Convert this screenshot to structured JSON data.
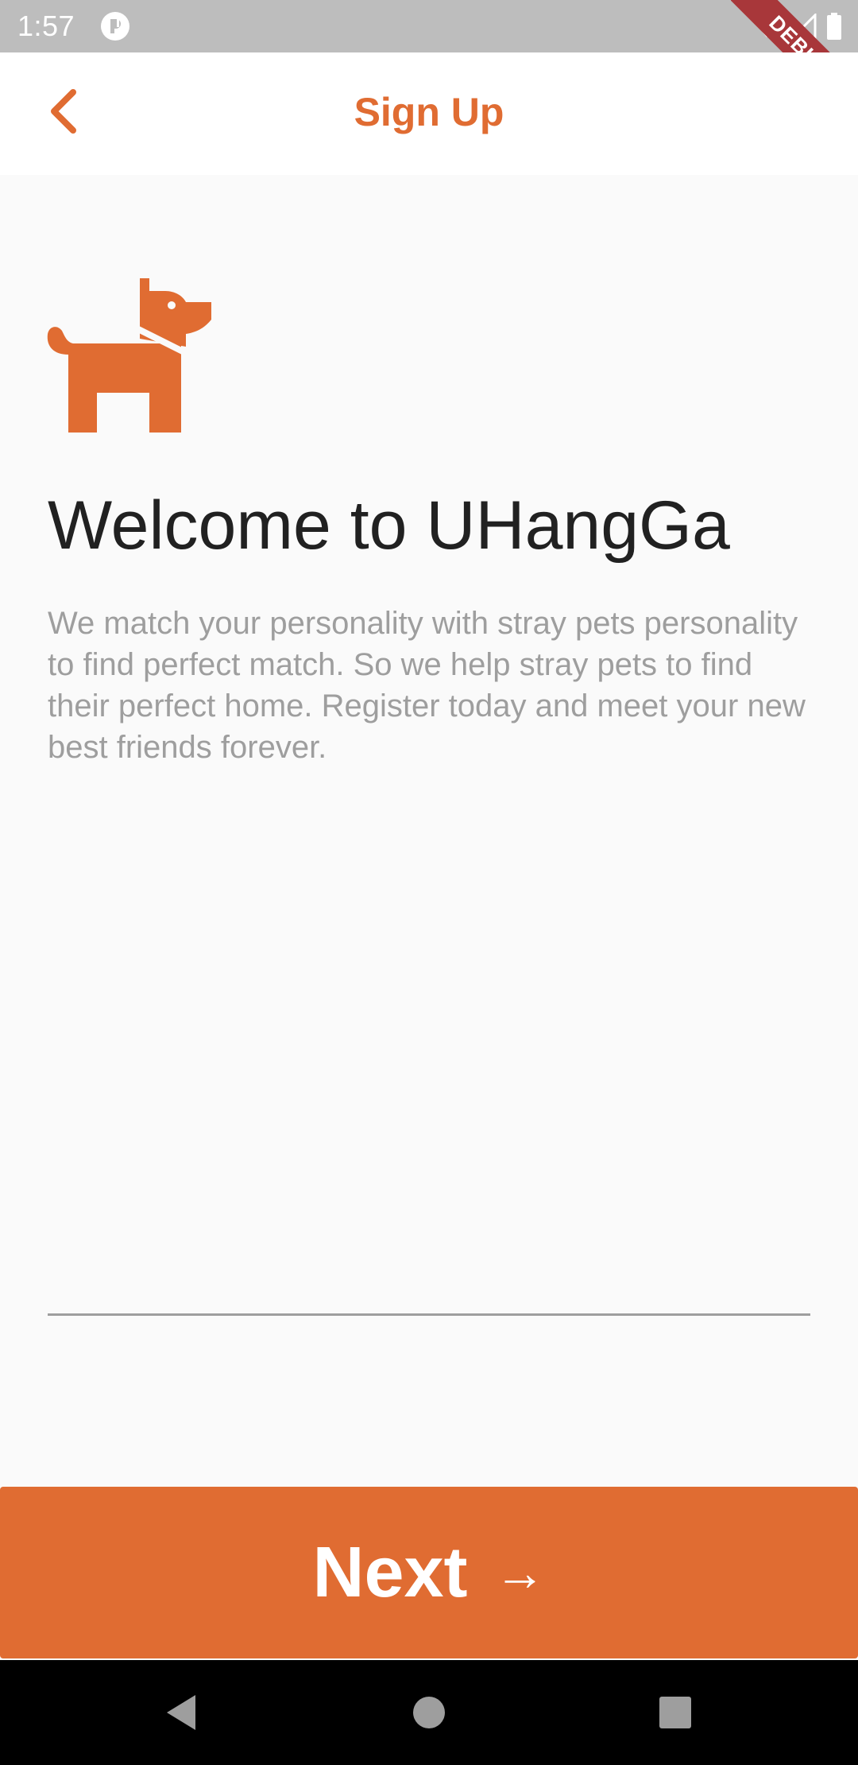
{
  "status_bar": {
    "time": "1:57",
    "icons": [
      "app-notification-icon",
      "wifi-icon",
      "cell-signal-icon",
      "battery-icon"
    ]
  },
  "debug_banner": "DEBUG",
  "app_bar": {
    "title": "Sign Up",
    "back_icon": "chevron-left-icon"
  },
  "main": {
    "logo_icon": "dog-icon",
    "title": "Welcome to UHangGa",
    "description": "We match your personality with stray pets personality to find perfect match. So we help stray pets to find their perfect home. Register today and meet your new best friends forever.",
    "input_value": ""
  },
  "next_button": {
    "label": "Next",
    "arrow": "→"
  },
  "nav_bar": {
    "icons": [
      "back-triangle-icon",
      "home-circle-icon",
      "recent-square-icon"
    ]
  },
  "colors": {
    "accent": "#e06c32",
    "status_bar": "#bdbdbd",
    "background": "#fafafa",
    "title_text": "#212121",
    "muted_text": "#9e9e9e",
    "debug_ribbon": "#a8373a"
  }
}
